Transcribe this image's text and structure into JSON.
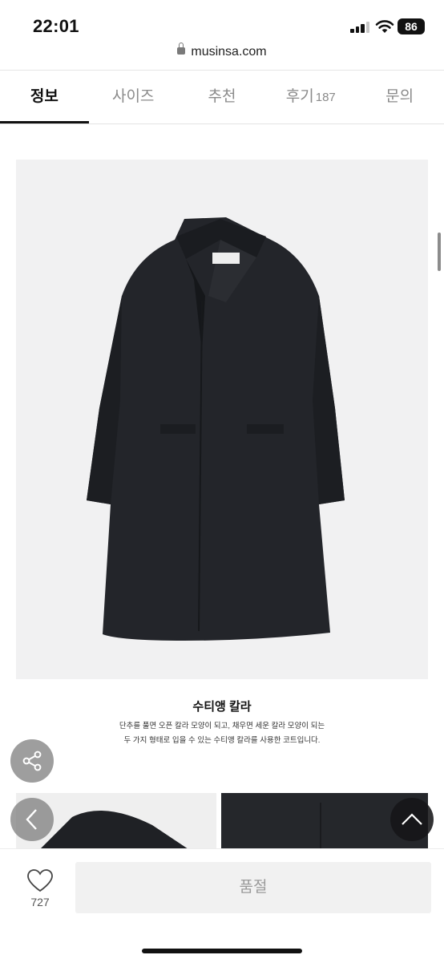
{
  "status_bar": {
    "time": "22:01",
    "battery": "86"
  },
  "url_bar": {
    "domain": "musinsa.com"
  },
  "tabs": [
    {
      "label": "정보",
      "active": true
    },
    {
      "label": "사이즈",
      "active": false
    },
    {
      "label": "추천",
      "active": false
    },
    {
      "label": "후기",
      "count": "187",
      "active": false
    },
    {
      "label": "문의",
      "active": false
    }
  ],
  "product": {
    "feature_title": "수티앵 칼라",
    "feature_desc_line1": "단추를 풀면 오픈 칼라 모양이 되고, 채우면 세운 칼라 모양이 되는",
    "feature_desc_line2": "두 가지 형태로 입을 수 있는 수티앵 칼라를 사용한 코트입니다."
  },
  "floating_buttons": [
    "share-icon",
    "chevron-left-icon",
    "chevron-up-icon"
  ],
  "bottom_bar": {
    "like_count": "727",
    "soldout_label": "품절"
  },
  "colors": {
    "active_tab": "#111111",
    "inactive_tab": "#8a8a8a",
    "soldout_bg": "#f1f1f1",
    "coat": "#23252a"
  }
}
